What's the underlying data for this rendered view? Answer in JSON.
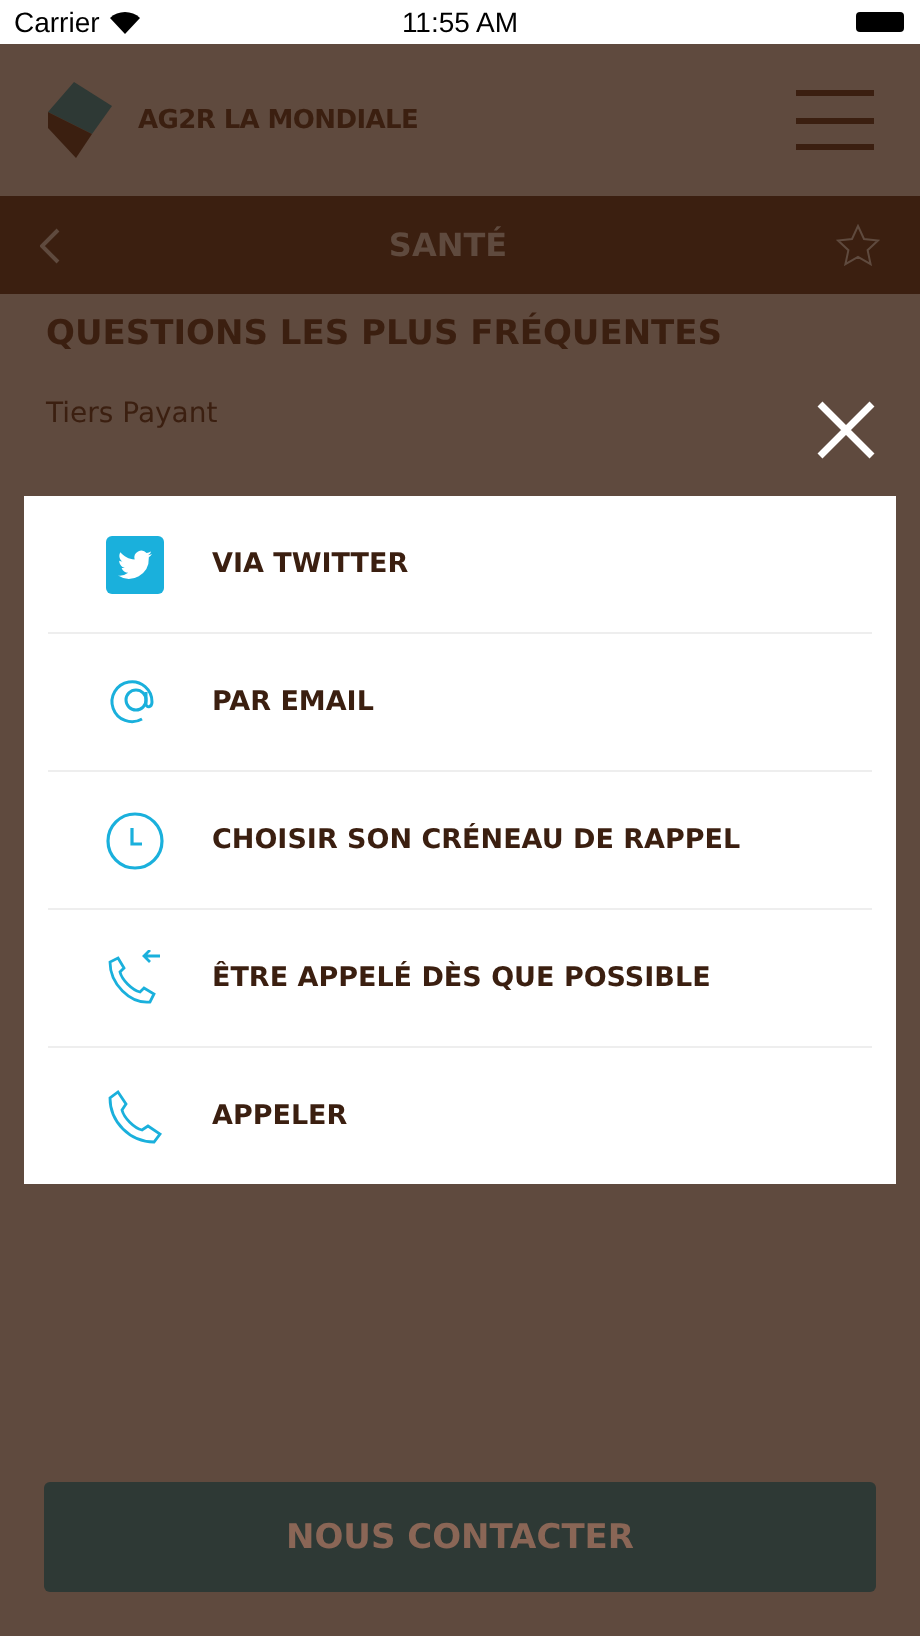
{
  "status_bar": {
    "carrier": "Carrier",
    "time": "11:55 AM"
  },
  "header": {
    "logo_text": "AG2R LA MONDIALE"
  },
  "nav_bar": {
    "title": "SANTÉ"
  },
  "section_title": "QUESTIONS LES PLUS FRÉQUENTES",
  "questions": [
    "Tiers Payant"
  ],
  "contact_menu": {
    "items": [
      {
        "kind": "twitter",
        "label": "VIA TWITTER"
      },
      {
        "kind": "email",
        "label": "PAR EMAIL"
      },
      {
        "kind": "clock",
        "label": "CHOISIR SON CRÉNEAU DE RAPPEL"
      },
      {
        "kind": "callback",
        "label": "ÊTRE APPELÉ DÈS QUE POSSIBLE"
      },
      {
        "kind": "phone",
        "label": "APPELER"
      }
    ]
  },
  "contact_button": "NOUS CONTACTER"
}
